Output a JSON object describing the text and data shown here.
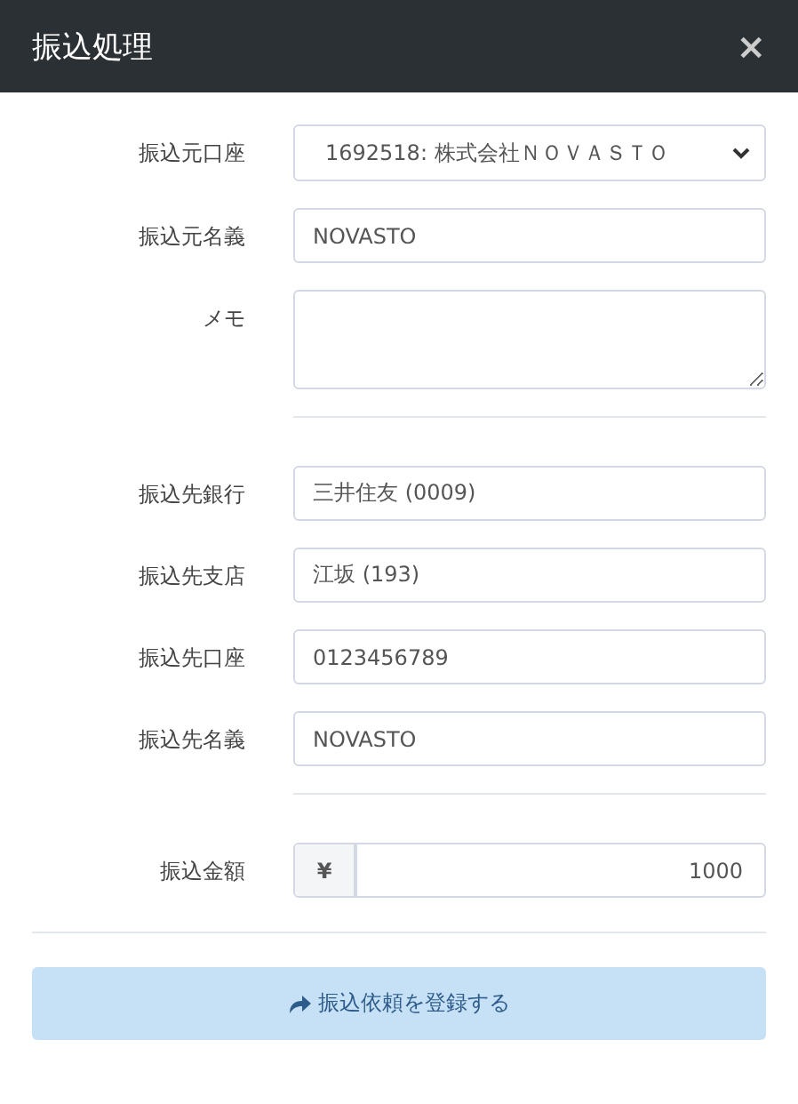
{
  "dialog": {
    "title": "振込処理",
    "close": "×"
  },
  "sections": [
    {
      "fields": [
        {
          "kind": "select",
          "label": "振込元口座",
          "value": "1692518: 株式会社ＮＯＶＡＳＴＯ"
        },
        {
          "kind": "text",
          "label": "振込元名義",
          "value": "NOVASTO"
        },
        {
          "kind": "textarea",
          "label": "メモ"
        }
      ]
    },
    {
      "fields": [
        {
          "kind": "text",
          "label": "振込先銀行",
          "value": "三井住友 (0009)"
        },
        {
          "kind": "text",
          "label": "振込先支店",
          "value": "江坂 (193)"
        },
        {
          "kind": "text",
          "label": "振込先口座",
          "value": "0123456789"
        },
        {
          "kind": "text",
          "label": "振込先名義",
          "value": "NOVASTO"
        }
      ]
    },
    {
      "fields": [
        {
          "kind": "currency",
          "label": "振込金額",
          "prefix": "¥",
          "value": "1000"
        }
      ]
    }
  ],
  "submit": {
    "label": "振込依頼を登録する"
  }
}
